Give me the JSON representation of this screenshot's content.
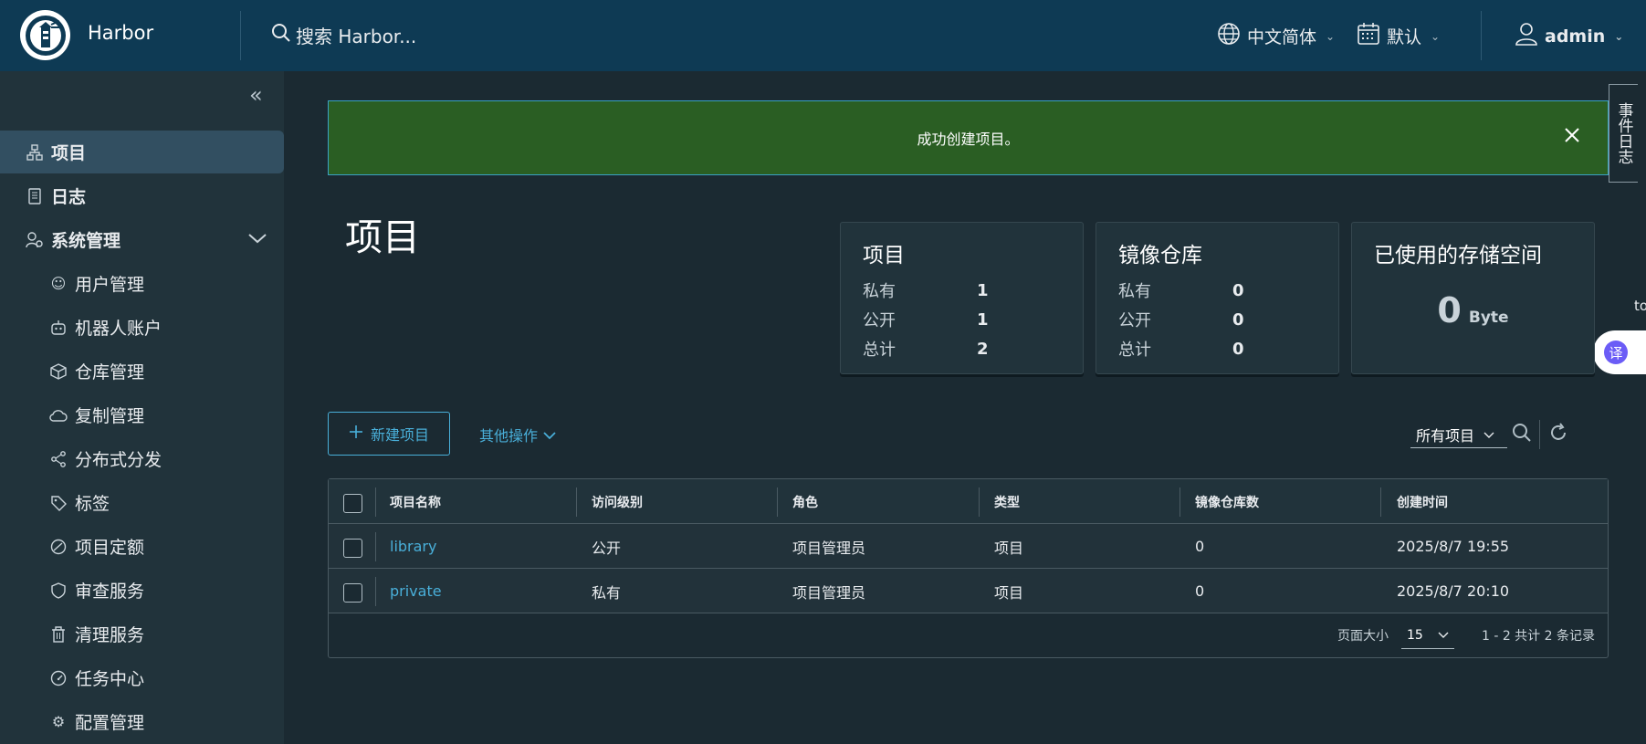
{
  "header": {
    "brand": "Harbor",
    "search_placeholder": "搜索 Harbor...",
    "language": "中文简体",
    "datetime_format": "默认",
    "user": "admin"
  },
  "sidebar": {
    "items": [
      {
        "label": "项目",
        "icon": "projects-icon",
        "active": true
      },
      {
        "label": "日志",
        "icon": "logs-icon"
      },
      {
        "label": "系统管理",
        "icon": "admin-icon",
        "expanded": true
      }
    ],
    "sub_items": [
      {
        "label": "用户管理",
        "icon": "users-icon"
      },
      {
        "label": "机器人账户",
        "icon": "robot-icon"
      },
      {
        "label": "仓库管理",
        "icon": "registry-icon"
      },
      {
        "label": "复制管理",
        "icon": "cloud-icon"
      },
      {
        "label": "分布式分发",
        "icon": "share-icon"
      },
      {
        "label": "标签",
        "icon": "tag-icon"
      },
      {
        "label": "项目定额",
        "icon": "quota-icon"
      },
      {
        "label": "审查服务",
        "icon": "shield-icon"
      },
      {
        "label": "清理服务",
        "icon": "trash-icon"
      },
      {
        "label": "任务中心",
        "icon": "dashboard-icon"
      },
      {
        "label": "配置管理",
        "icon": "gear-icon"
      }
    ]
  },
  "alert": {
    "message": "成功创建项目。"
  },
  "side_tab": {
    "label": "事件日志"
  },
  "side_text": "to",
  "translate_button": "译",
  "page": {
    "title": "项目"
  },
  "cards": {
    "projects": {
      "title": "项目",
      "rows": [
        {
          "label": "私有",
          "value": "1"
        },
        {
          "label": "公开",
          "value": "1"
        },
        {
          "label": "总计",
          "value": "2"
        }
      ]
    },
    "repositories": {
      "title": "镜像仓库",
      "rows": [
        {
          "label": "私有",
          "value": "0"
        },
        {
          "label": "公开",
          "value": "0"
        },
        {
          "label": "总计",
          "value": "0"
        }
      ]
    },
    "storage": {
      "title": "已使用的存储空间",
      "value": "0",
      "unit": "Byte"
    }
  },
  "toolbar": {
    "new_project": "新建项目",
    "other_actions": "其他操作",
    "filter": "所有项目"
  },
  "table": {
    "columns": [
      "项目名称",
      "访问级别",
      "角色",
      "类型",
      "镜像仓库数",
      "创建时间"
    ],
    "rows": [
      [
        "library",
        "公开",
        "项目管理员",
        "项目",
        "0",
        "2025/8/7 19:55"
      ],
      [
        "private",
        "私有",
        "项目管理员",
        "项目",
        "0",
        "2025/8/7 20:10"
      ]
    ],
    "footer": {
      "page_size_label": "页面大小",
      "page_size": "15",
      "summary": "1 - 2 共计 2 条记录"
    }
  }
}
